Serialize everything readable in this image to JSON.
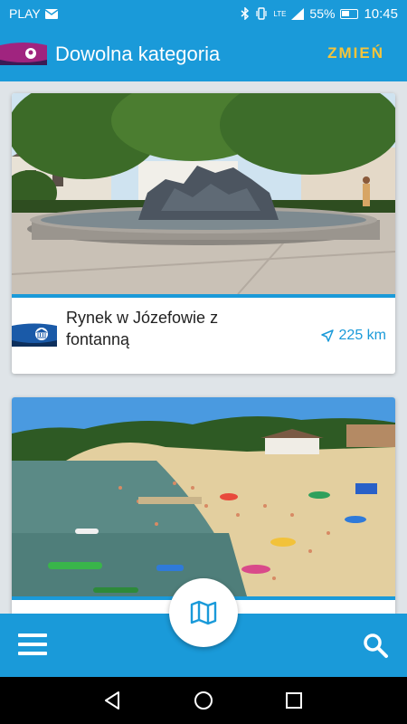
{
  "status_bar": {
    "carrier": "PLAY",
    "signal_label": "LTE",
    "battery_percent": "55%",
    "time": "10:45"
  },
  "app_bar": {
    "title": "Dowolna kategoria",
    "change_label": "ZMIEŃ"
  },
  "cards": [
    {
      "title": "Rynek w Józefowie z fontanną",
      "distance": "225 km",
      "icon": "museum-icon"
    },
    {
      "title": "",
      "distance": "",
      "icon": ""
    }
  ],
  "bottom_bar": {
    "icons": [
      "menu-icon",
      "map-icon",
      "search-icon"
    ]
  },
  "colors": {
    "primary": "#1a9ad9",
    "accent": "#f5c43a",
    "badge_purple": "#a0247f",
    "text": "#222222"
  }
}
